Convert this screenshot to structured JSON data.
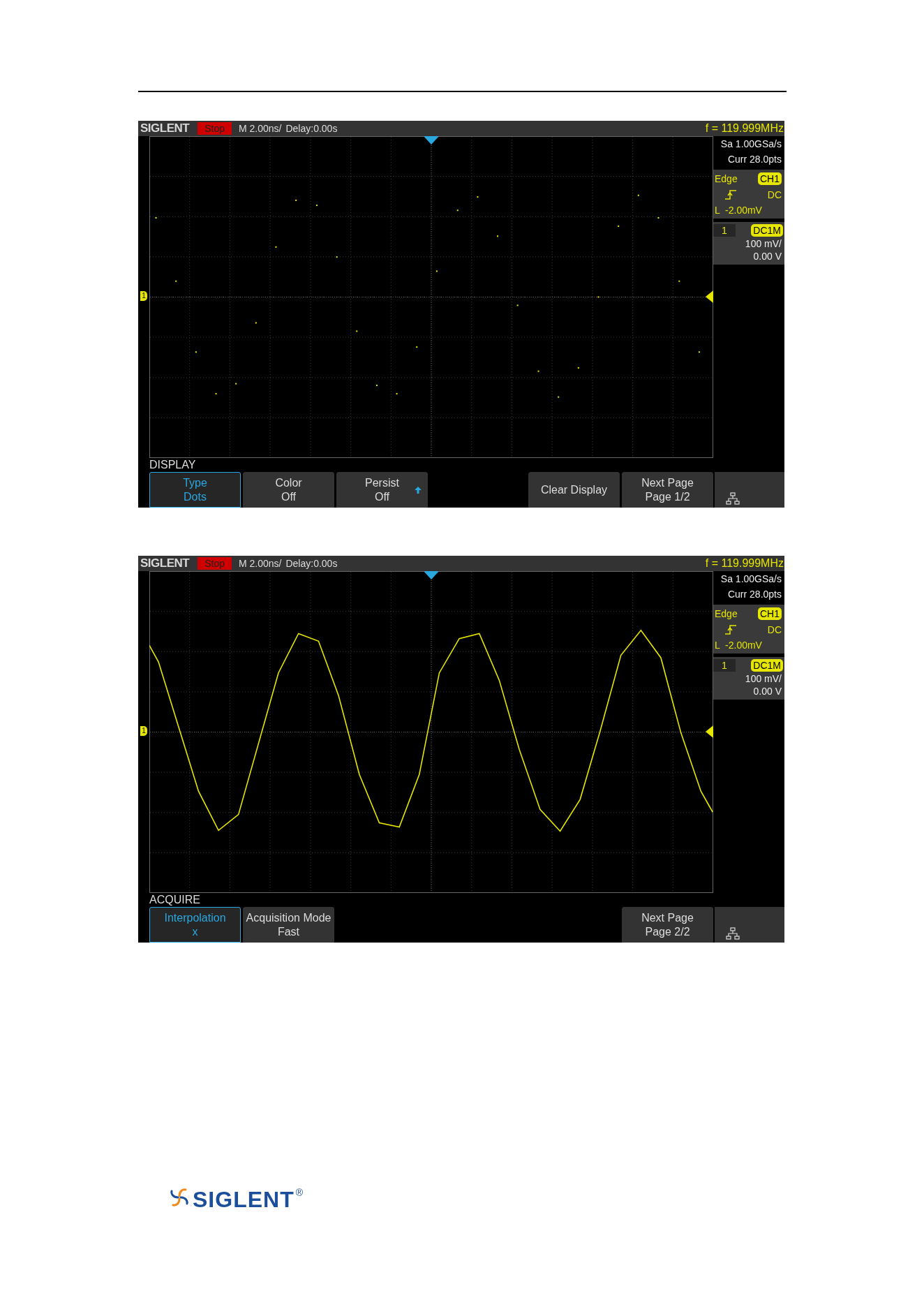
{
  "screens": [
    {
      "header": {
        "brand": "SIGLENT",
        "run_state": "Stop",
        "timebase": "M 2.00ns/",
        "delay": "Delay:0.00s",
        "frequency": "f = 119.999MHz"
      },
      "side_panel": {
        "sample_rate": "Sa 1.00GSa/s",
        "memory_depth": "Curr 28.0pts",
        "trigger": {
          "type": "Edge",
          "source": "CH1",
          "coupling": "DC",
          "level": "L  -2.00mV"
        },
        "channel": {
          "number": "1",
          "coupling": "DC1M",
          "scale": "100 mV/",
          "offset": "0.00 V"
        }
      },
      "channel_marker": "1",
      "trace": {
        "kind": "dots"
      },
      "menu": {
        "title": "DISPLAY",
        "left_buttons": [
          {
            "lines": [
              "Type",
              "Dots"
            ],
            "selected": true,
            "adjustable": false
          },
          {
            "lines": [
              "Color",
              "Off"
            ],
            "selected": false,
            "adjustable": false
          },
          {
            "lines": [
              "Persist",
              "Off"
            ],
            "selected": false,
            "adjustable": true
          }
        ],
        "right_buttons": [
          {
            "lines": [
              "Clear Display"
            ],
            "selected": false,
            "adjustable": false
          },
          {
            "lines": [
              "Next Page",
              "Page 1/2"
            ],
            "selected": false,
            "adjustable": false
          }
        ]
      }
    },
    {
      "header": {
        "brand": "SIGLENT",
        "run_state": "Stop",
        "timebase": "M 2.00ns/",
        "delay": "Delay:0.00s",
        "frequency": "f = 119.999MHz"
      },
      "side_panel": {
        "sample_rate": "Sa 1.00GSa/s",
        "memory_depth": "Curr 28.0pts",
        "trigger": {
          "type": "Edge",
          "source": "CH1",
          "coupling": "DC",
          "level": "L  -2.00mV"
        },
        "channel": {
          "number": "1",
          "coupling": "DC1M",
          "scale": "100 mV/",
          "offset": "0.00 V"
        }
      },
      "channel_marker": "1",
      "trace": {
        "kind": "line"
      },
      "menu": {
        "title": "ACQUIRE",
        "left_buttons": [
          {
            "lines": [
              "Interpolation",
              "x"
            ],
            "selected": true,
            "adjustable": false
          },
          {
            "lines": [
              "Acquisition Mode",
              "Fast"
            ],
            "selected": false,
            "adjustable": false
          }
        ],
        "right_buttons": [
          {
            "lines": [
              "Next Page",
              "Page 2/2"
            ],
            "selected": false,
            "adjustable": false
          }
        ]
      }
    }
  ],
  "footer": {
    "logo": "SIGLENT",
    "registered": "®"
  }
}
